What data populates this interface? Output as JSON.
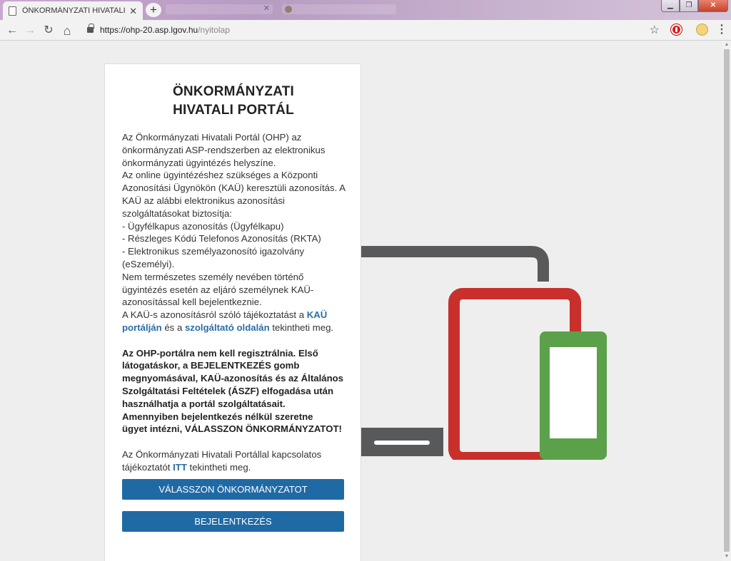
{
  "browser": {
    "tab_title": "ÖNKORMÁNYZATI HIVATALI PORTÁL",
    "tab_close": "✕",
    "new_tab": "+",
    "url_host": "https://ohp-20.asp.lgov.hu",
    "url_path": "/nyitolap",
    "window_min": "▁",
    "window_max": "❐",
    "window_close": "✕",
    "back": "←",
    "forward": "→",
    "reload": "↻",
    "home": "⌂",
    "star": "☆",
    "menu": "⋮"
  },
  "card": {
    "title_line1": "ÖNKORMÁNYZATI",
    "title_line2": "HIVATALI PORTÁL",
    "intro_lines": [
      "Az Önkormányzati Hivatali Portál (OHP) az",
      "önkormányzati ASP-rendszerben az elektronikus",
      "önkormányzati ügyintézés helyszíne.",
      "Az online ügyintézéshez szükséges a Központi",
      "Azonosítási Ügynökön (KAÜ) keresztüli azonosítás. A",
      "KAÜ az alábbi elektronikus azonosítási",
      "szolgáltatásokat biztosítja:",
      "- Ügyfélkapus azonosítás (Ügyfélkapu)",
      "- Részleges Kódú Telefonos Azonosítás (RKTA)",
      "- Elektronikus személyazonosító igazolvány",
      "(eSzemélyi).",
      "Nem természetes személy nevében történő",
      "ügyintézés esetén az eljáró személynek KAÜ-",
      "azonosítással kell bejelentkeznie."
    ],
    "info_prefix": "A KAÜ-s azonosításról szóló tájékoztatást a ",
    "kau_link_part1": "KAÜ",
    "kau_link_part2": "portálján",
    "info_middle": " és a ",
    "provider_link": "szolgáltató oldalán",
    "info_suffix": " tekintheti meg.",
    "bold_lines": [
      "Az OHP-portálra nem kell regisztrálnia. Első",
      "látogatáskor, a BEJELENTKEZÉS gomb",
      "megnyomásával, KAÜ-azonosítás és az Általános",
      "Szolgáltatási Feltételek (ÁSZF) elfogadása után",
      "használhatja a portál szolgáltatásait.",
      "Amennyiben bejelentkezés nélkül szeretne",
      "ügyet intézni, VÁLASSZON ÖNKORMÁNYZATOT!"
    ],
    "contact_line1": "Az Önkormányzati Hivatali Portállal kapcsolatos",
    "contact_prefix": "tájékoztatót ",
    "contact_link": "ITT",
    "contact_suffix": " tekintheti meg.",
    "select_button": "VÁLASSZON ÖNKORMÁNYZATOT",
    "login_button": "BEJELENTKEZÉS"
  },
  "colors": {
    "button": "#1f6aa5",
    "link": "#2a6ea6",
    "laptop": "#58595b",
    "tablet": "#c9302c",
    "phone": "#5ba14a"
  }
}
